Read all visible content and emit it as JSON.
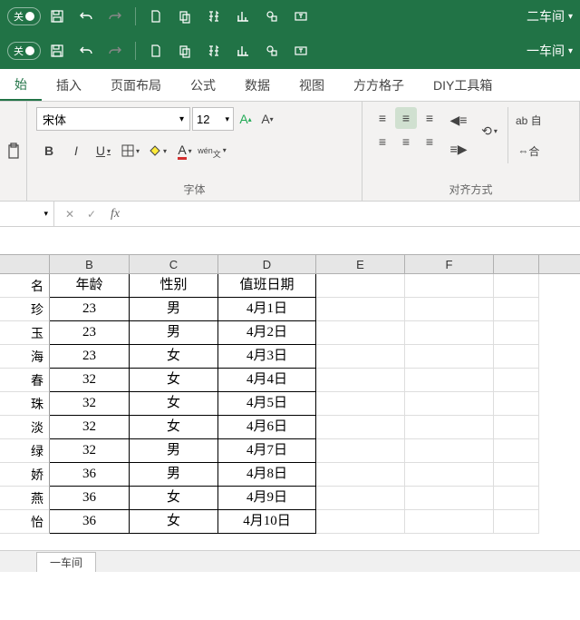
{
  "qat": {
    "toggle_label": "关",
    "workbook1": "二车间",
    "workbook2": "一车间"
  },
  "tabs": {
    "home": "始",
    "insert": "插入",
    "page_layout": "页面布局",
    "formulas": "公式",
    "data": "数据",
    "view": "视图",
    "fangfang": "方方格子",
    "diy": "DIY工具箱"
  },
  "ribbon": {
    "font_name": "宋体",
    "font_size": "12",
    "font_inc": "A",
    "font_dec": "A",
    "bold": "B",
    "italic": "I",
    "underline": "U",
    "wen": "wén",
    "font_group": "字体",
    "align_group": "对齐方式",
    "ab_wrap": "ab 自",
    "merge": "合"
  },
  "formula_bar": {
    "namebox": "",
    "fx": "fx"
  },
  "columns": {
    "B": "B",
    "C": "C",
    "D": "D",
    "E": "E",
    "F": "F"
  },
  "headers": {
    "A": "名",
    "B": "年龄",
    "C": "性别",
    "D": "值班日期"
  },
  "rows": [
    {
      "A": "珍",
      "B": "23",
      "C": "男",
      "D": "4月1日"
    },
    {
      "A": "玉",
      "B": "23",
      "C": "男",
      "D": "4月2日"
    },
    {
      "A": "海",
      "B": "23",
      "C": "女",
      "D": "4月3日"
    },
    {
      "A": "春",
      "B": "32",
      "C": "女",
      "D": "4月4日"
    },
    {
      "A": "珠",
      "B": "32",
      "C": "女",
      "D": "4月5日"
    },
    {
      "A": "淡",
      "B": "32",
      "C": "女",
      "D": "4月6日"
    },
    {
      "A": "绿",
      "B": "32",
      "C": "男",
      "D": "4月7日"
    },
    {
      "A": "娇",
      "B": "36",
      "C": "男",
      "D": "4月8日"
    },
    {
      "A": "燕",
      "B": "36",
      "C": "女",
      "D": "4月9日"
    },
    {
      "A": "怡",
      "B": "36",
      "C": "女",
      "D": "4月10日"
    }
  ],
  "sheet_tab": "一车间"
}
